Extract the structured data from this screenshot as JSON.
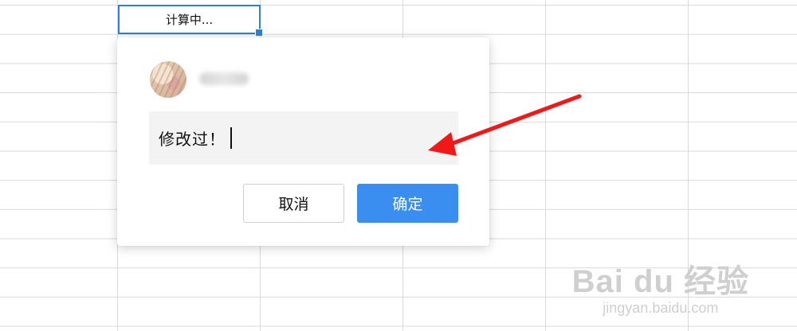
{
  "sheet": {
    "active_cell_text": "计算中..."
  },
  "comment": {
    "text": "修改过！",
    "cancel_label": "取消",
    "confirm_label": "确定"
  },
  "annotation": {
    "arrow_color": "#f01818"
  },
  "watermark": {
    "main": "Bai du 经验",
    "sub": "jingyan.baidu.com"
  },
  "colors": {
    "primary": "#3a8ef0",
    "selection": "#2f7de1",
    "grid": "#d9d9d9"
  }
}
